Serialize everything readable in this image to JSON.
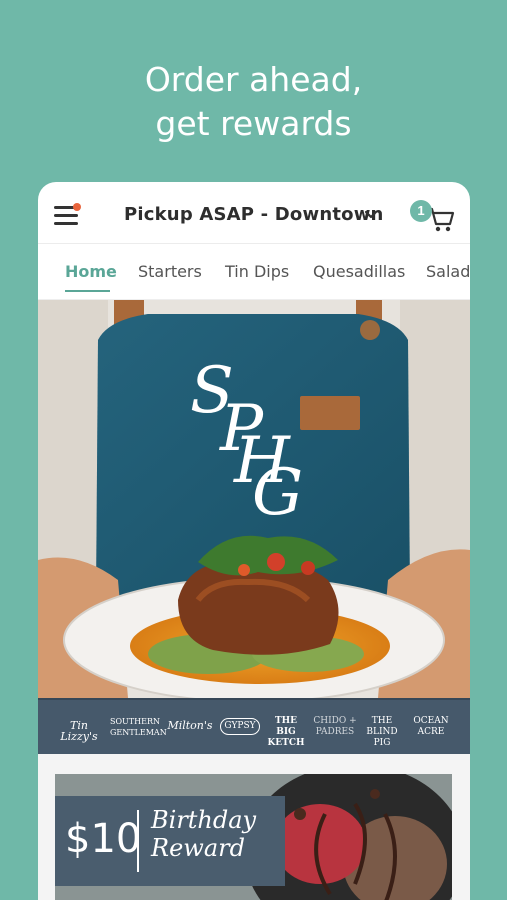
{
  "headline": {
    "line1": "Order ahead,",
    "line2": "get rewards"
  },
  "header": {
    "location": "Pickup ASAP - Downtown",
    "cart_count": "1"
  },
  "tabs": [
    {
      "label": "Home"
    },
    {
      "label": "Starters"
    },
    {
      "label": "Tin Dips"
    },
    {
      "label": "Quesadillas"
    },
    {
      "label": "Salads"
    }
  ],
  "hero": {
    "monogram": [
      "S",
      "P",
      "H",
      "G"
    ]
  },
  "brands": [
    {
      "name": "Tin Lizzy's"
    },
    {
      "name": "SOUTHERN GENTLEMAN"
    },
    {
      "name": "Milton's"
    },
    {
      "name": "GYPSY"
    },
    {
      "name": "THE BIG KETCH"
    },
    {
      "name": "CHIDO + PADRES"
    },
    {
      "name": "THE BLIND PIG"
    },
    {
      "name": "OCEAN ACRE"
    }
  ],
  "promo": {
    "amount": "$10",
    "title": "Birthday Reward"
  },
  "colors": {
    "accent": "#6fb8a8",
    "navy": "#46596b",
    "alert": "#e8643c"
  }
}
